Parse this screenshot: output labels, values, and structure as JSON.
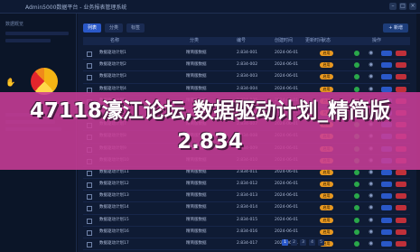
{
  "window": {
    "title": "Admin5000数据平台 - 业务报表管理系统"
  },
  "sidebar": {
    "heading": "数据概览"
  },
  "toolbar": {
    "tabs": [
      "列表",
      "分类",
      "标签"
    ],
    "action": "+ 新增"
  },
  "table": {
    "columns": [
      "",
      "名称",
      "分类",
      "编号",
      "创建时间",
      "更新时间",
      "状态",
      "操作"
    ],
    "rows": [
      {
        "name": "数据驱动计划1",
        "cat": "精简版数据",
        "code": "2.834-001",
        "created": "2024-06-01",
        "updated": "2024-06-02",
        "status": "启用"
      },
      {
        "name": "数据驱动计划2",
        "cat": "精简版数据",
        "code": "2.834-002",
        "created": "2024-06-01",
        "updated": "2024-06-02",
        "status": "启用"
      },
      {
        "name": "数据驱动计划3",
        "cat": "精简版数据",
        "code": "2.834-003",
        "created": "2024-06-01",
        "updated": "2024-06-02",
        "status": "启用"
      },
      {
        "name": "数据驱动计划4",
        "cat": "精简版数据",
        "code": "2.834-004",
        "created": "2024-06-01",
        "updated": "2024-06-02",
        "status": "启用"
      },
      {
        "name": "数据驱动计划5",
        "cat": "精简版数据",
        "code": "2.834-005",
        "created": "2024-06-01",
        "updated": "2024-06-02",
        "status": "启用"
      },
      {
        "name": "数据驱动计划6",
        "cat": "精简版数据",
        "code": "2.834-006",
        "created": "2024-06-01",
        "updated": "2024-06-02",
        "status": "启用"
      },
      {
        "name": "数据驱动计划7",
        "cat": "精简版数据",
        "code": "2.834-007",
        "created": "2024-06-01",
        "updated": "2024-06-02",
        "status": "启用"
      },
      {
        "name": "数据驱动计划8",
        "cat": "精简版数据",
        "code": "2.834-008",
        "created": "2024-06-01",
        "updated": "2024-06-02",
        "status": "启用"
      },
      {
        "name": "数据驱动计划9",
        "cat": "精简版数据",
        "code": "2.834-009",
        "created": "2024-06-01",
        "updated": "2024-06-02",
        "status": "启用"
      },
      {
        "name": "数据驱动计划10",
        "cat": "精简版数据",
        "code": "2.834-010",
        "created": "2024-06-01",
        "updated": "2024-06-02",
        "status": "启用"
      },
      {
        "name": "数据驱动计划11",
        "cat": "精简版数据",
        "code": "2.834-011",
        "created": "2024-06-01",
        "updated": "2024-06-02",
        "status": "启用"
      },
      {
        "name": "数据驱动计划12",
        "cat": "精简版数据",
        "code": "2.834-012",
        "created": "2024-06-01",
        "updated": "2024-06-02",
        "status": "启用"
      },
      {
        "name": "数据驱动计划13",
        "cat": "精简版数据",
        "code": "2.834-013",
        "created": "2024-06-01",
        "updated": "2024-06-02",
        "status": "启用"
      },
      {
        "name": "数据驱动计划14",
        "cat": "精简版数据",
        "code": "2.834-014",
        "created": "2024-06-01",
        "updated": "2024-06-02",
        "status": "启用"
      },
      {
        "name": "数据驱动计划15",
        "cat": "精简版数据",
        "code": "2.834-015",
        "created": "2024-06-01",
        "updated": "2024-06-02",
        "status": "启用"
      },
      {
        "name": "数据驱动计划16",
        "cat": "精简版数据",
        "code": "2.834-016",
        "created": "2024-06-01",
        "updated": "2024-06-02",
        "status": "启用"
      },
      {
        "name": "数据驱动计划17",
        "cat": "精简版数据",
        "code": "2.834-017",
        "created": "2024-06-01",
        "updated": "2024-06-02",
        "status": "启用"
      }
    ]
  },
  "pagination": {
    "pages": [
      "1",
      "2",
      "3",
      "4",
      "5"
    ],
    "current": "1"
  },
  "overlay": {
    "headline": "47118濠江论坛,数据驱动计划_精简版2.834"
  },
  "colors": {
    "accent": "#2a58c8",
    "badge": "#e89820",
    "banner": "#c83c96",
    "ok": "#2aa84a"
  },
  "icons": {
    "window": [
      "minimize-icon",
      "maximize-icon",
      "close-icon"
    ],
    "row": [
      "status-dot-icon",
      "eye-icon",
      "edit-icon"
    ]
  }
}
